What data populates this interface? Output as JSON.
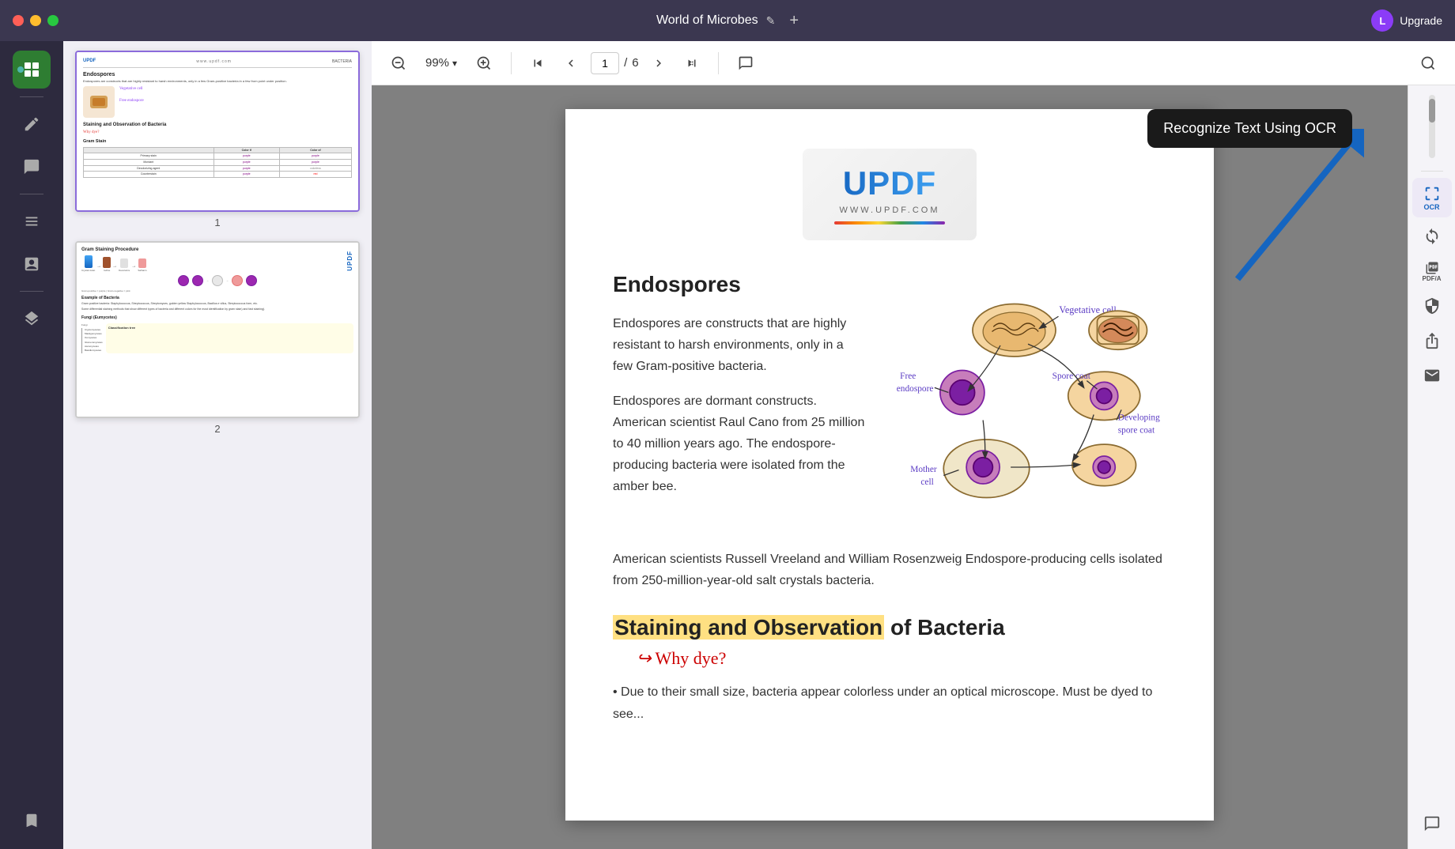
{
  "titlebar": {
    "title": "World of Microbes",
    "edit_icon": "✎",
    "new_tab_label": "+",
    "upgrade_label": "Upgrade",
    "avatar_letter": "L"
  },
  "window_controls": {
    "close_label": "",
    "min_label": "",
    "max_label": ""
  },
  "toolbar": {
    "zoom_out_label": "−",
    "zoom_in_label": "+",
    "zoom_level": "99%",
    "zoom_dropdown": "▾",
    "page_current": "1",
    "page_separator": "/",
    "page_total": "6",
    "first_page_label": "⏮",
    "prev_page_label": "⌃",
    "next_page_label": "⌄",
    "last_page_label": "⏭",
    "comment_label": "💬",
    "search_label": "⌕"
  },
  "left_sidebar": {
    "icons": [
      {
        "name": "thumbnail-view",
        "symbol": "▦",
        "active": true
      },
      {
        "name": "annotation",
        "symbol": "✏",
        "active": false
      },
      {
        "name": "comment",
        "symbol": "📝",
        "active": false
      },
      {
        "name": "separator1"
      },
      {
        "name": "organize",
        "symbol": "⊞",
        "active": false
      },
      {
        "name": "forms",
        "symbol": "📋",
        "active": false
      },
      {
        "name": "separator2"
      },
      {
        "name": "layers",
        "symbol": "⊕",
        "active": false
      },
      {
        "name": "bookmark",
        "symbol": "🔖",
        "active": false
      }
    ],
    "dot_indicator": true
  },
  "right_sidebar": {
    "icons": [
      {
        "name": "ocr",
        "symbol": "OCR",
        "label": "OCR"
      },
      {
        "name": "convert",
        "symbol": "⟲"
      },
      {
        "name": "pdf-a",
        "symbol": "PDF/A"
      },
      {
        "name": "protect",
        "symbol": "🔒"
      },
      {
        "name": "share",
        "symbol": "↑"
      },
      {
        "name": "mail",
        "symbol": "✉"
      },
      {
        "name": "chat",
        "symbol": "💬"
      }
    ]
  },
  "ocr_tooltip": {
    "text": "Recognize Text Using OCR"
  },
  "pdf_content": {
    "updf_url": "WWW.UPDF.COM",
    "section1_title": "Endospores",
    "para1": "Endospores are constructs that are highly resistant to harsh environments, only in a few Gram-positive bacteria.",
    "para2": "Endospores are dormant constructs. American scientist Raul Cano from 25 million to 40 million years ago. The endospore-producing bacteria were isolated from the amber bee.",
    "para3": "American scientists Russell Vreeland and William Rosenzweig Endospore-producing cells isolated from 250-million-year-old salt crystals bacteria.",
    "section2_title_highlighted": "Staining and Observation",
    "section2_title_rest": " of Bacteria",
    "why_dye": "Why dye?",
    "bullet1": "Due to their small size, bacteria appear colorless under an optical microscope. Must be dyed to see...",
    "diagram_labels": {
      "vegetative_cell": "Vegetative cell",
      "free_endospore": "Free endospore",
      "spore_coat": "Spore coat",
      "developing_spore_coat": "Developing spore coat",
      "mother_cell": "Mother cell"
    }
  },
  "thumbnails": {
    "page1": {
      "number": "1",
      "updf_text": "UPDF",
      "bacteria_label": "BACTERIA",
      "endospores_title": "Endospores",
      "staining_title": "Staining and Observation of Bacteria",
      "gram_stain_title": "Gram Stain",
      "gram_table_headers": [
        "",
        "Color if",
        "Color of"
      ],
      "gram_table_rows": [
        [
          "Primary stain (crystal violet)",
          "purple",
          "purple"
        ],
        [
          "Mordant (iodine)",
          "purple",
          "purple"
        ],
        [
          "Decolorizing agent (95% Ethanol)",
          "purple",
          "colorless"
        ],
        [
          "Counterstain (Safranin)",
          "purple",
          "red"
        ]
      ],
      "why_dye_label": "Why dye?"
    },
    "page2": {
      "number": "2",
      "title": "Gram Staining Procedure",
      "example_title": "Example of Bacteria",
      "fungi_title": "Fungi (Eumycetes)"
    }
  }
}
